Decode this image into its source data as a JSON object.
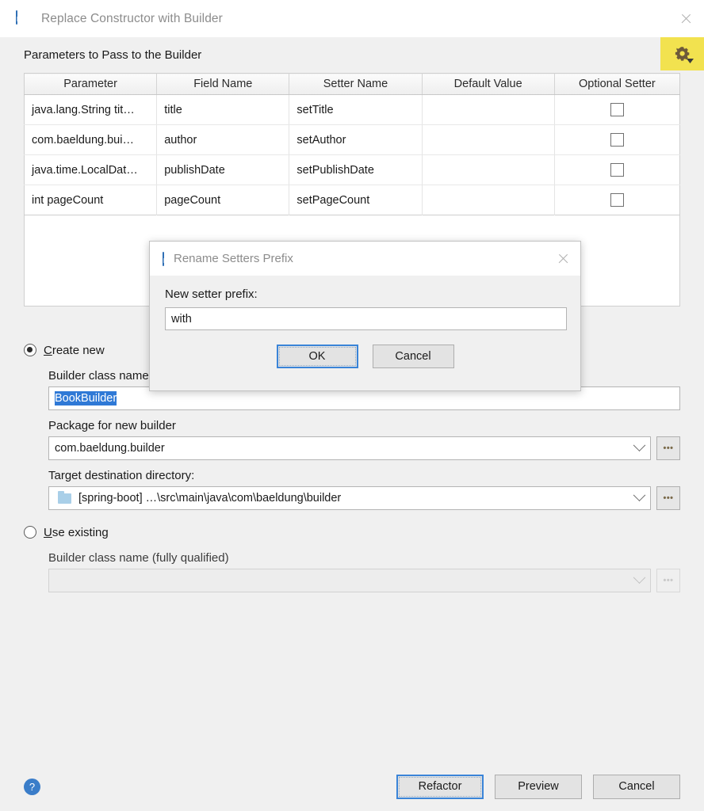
{
  "dialog": {
    "title": "Replace Constructor with Builder",
    "app_icon": "intellij-icon",
    "close_icon": "close-icon"
  },
  "params_section": {
    "label": "Parameters to Pass to the Builder",
    "gear_icon": "gear-icon",
    "gear_highlight_color": "#F2E24F",
    "table": {
      "columns": [
        "Parameter",
        "Field Name",
        "Setter Name",
        "Default Value",
        "Optional Setter"
      ],
      "rows": [
        {
          "parameter": "java.lang.String tit…",
          "field_name": "title",
          "setter_name": "setTitle",
          "default_value": "",
          "optional_setter": false
        },
        {
          "parameter": "com.baeldung.bui…",
          "field_name": "author",
          "setter_name": "setAuthor",
          "default_value": "",
          "optional_setter": false
        },
        {
          "parameter": "java.time.LocalDat…",
          "field_name": "publishDate",
          "setter_name": "setPublishDate",
          "default_value": "",
          "optional_setter": false
        },
        {
          "parameter": "int pageCount",
          "field_name": "pageCount",
          "setter_name": "setPageCount",
          "default_value": "",
          "optional_setter": false
        }
      ]
    }
  },
  "create_new": {
    "radio_label_prefix": "C",
    "radio_label_rest": "reate new",
    "selected": true,
    "builder_class_name_label": "Builder class name",
    "builder_class_name_value": "BookBuilder",
    "package_label": "Package for new builder",
    "package_value": "com.baeldung.builder",
    "package_dropdown_icon": "chevron-down-icon",
    "package_browse_label": "…",
    "target_dir_label": "Target destination directory:",
    "target_dir_value": "[spring-boot] …\\src\\main\\java\\com\\baeldung\\builder",
    "target_dir_folder_icon": "folder-icon",
    "target_dir_dropdown_icon": "chevron-down-icon",
    "target_dir_browse_label": "…"
  },
  "use_existing": {
    "radio_label_prefix": "U",
    "radio_label_rest": "se existing",
    "selected": false,
    "builder_class_label": "Builder class name (fully qualified)",
    "builder_class_value": "",
    "dropdown_icon": "chevron-down-icon",
    "browse_label": "…"
  },
  "footer": {
    "help_icon": "?",
    "refactor_label": "Refactor",
    "preview_label": "Preview",
    "cancel_label": "Cancel",
    "default_button": "Refactor",
    "focus_color": "#3A84D8"
  },
  "modal": {
    "title": "Rename Setters Prefix",
    "app_icon": "intellij-icon",
    "close_icon": "close-icon",
    "field_label": "New setter prefix:",
    "field_value": "with",
    "ok_label": "OK",
    "cancel_label": "Cancel",
    "default_button": "OK"
  }
}
